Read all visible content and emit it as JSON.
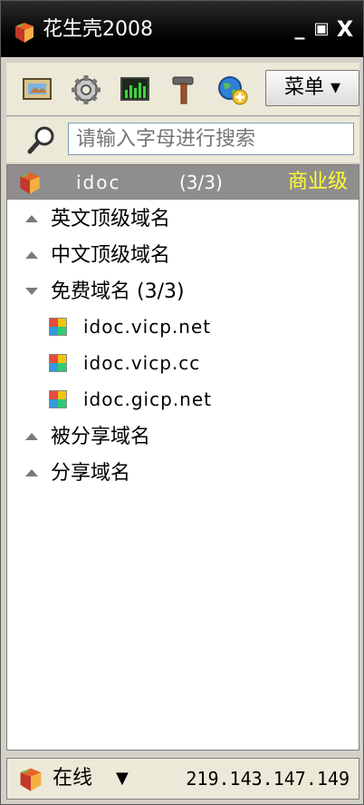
{
  "window": {
    "title": "花生壳2008",
    "min_label": "_",
    "max_label": "▣",
    "close_label": "X"
  },
  "toolbar": {
    "icons": [
      "screen-icon",
      "gear-icon",
      "monitor-chart-icon",
      "hammer-icon",
      "globe-add-icon"
    ],
    "menu_label": "菜单 ▾"
  },
  "search": {
    "placeholder": "请输入字母进行搜索",
    "value": ""
  },
  "account": {
    "name": "idoc",
    "count": "(3/3)",
    "level": "商业级"
  },
  "groups": [
    {
      "label": "英文顶级域名",
      "expanded": false
    },
    {
      "label": "中文顶级域名",
      "expanded": false
    },
    {
      "label": "免费域名 (3/3)",
      "expanded": true,
      "domains": [
        "idoc.vicp.net",
        "idoc.vicp.cc",
        "idoc.gicp.net"
      ]
    },
    {
      "label": "被分享域名",
      "expanded": false
    },
    {
      "label": "分享域名",
      "expanded": false
    }
  ],
  "status": {
    "state_label": "在线",
    "caret": "▼",
    "ip": "219.143.147.149"
  },
  "colors": {
    "titlebar": "#000000",
    "account_bg": "#8f8d8d",
    "level_text": "#ffff33"
  }
}
